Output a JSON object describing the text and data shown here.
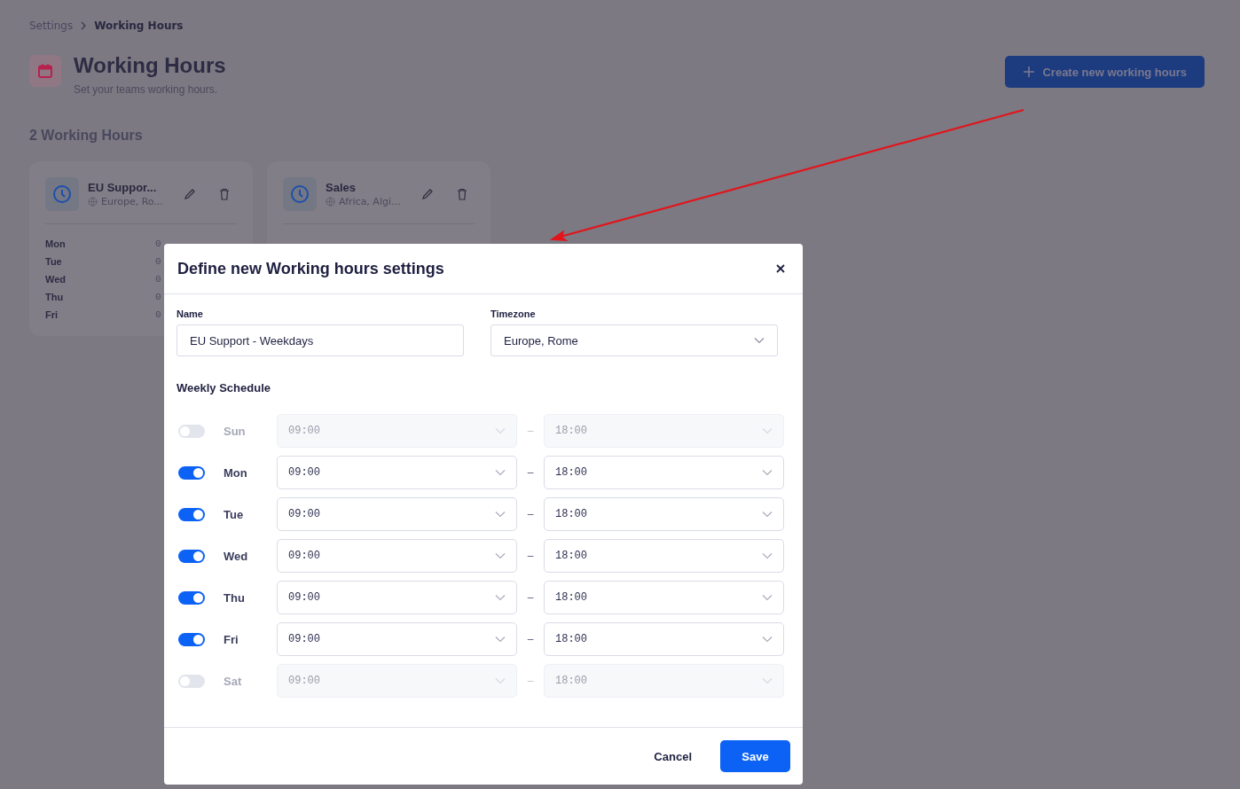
{
  "breadcrumb": [
    {
      "label": "Settings"
    },
    {
      "label": "Working Hours"
    }
  ],
  "header": {
    "title": "Working Hours",
    "subtitle": "Set your teams working hours."
  },
  "create_button": {
    "label": "Create new working hours"
  },
  "list_heading": "2 Working Hours",
  "cards": [
    {
      "name": "EU Suppor...",
      "timezone": "Europe, Ro...",
      "days": [
        {
          "day": "Mon",
          "time": "0"
        },
        {
          "day": "Tue",
          "time": "0"
        },
        {
          "day": "Wed",
          "time": "0"
        },
        {
          "day": "Thu",
          "time": "0"
        },
        {
          "day": "Fri",
          "time": "0"
        }
      ]
    },
    {
      "name": "Sales",
      "timezone": "Africa, Algi..."
    }
  ],
  "modal": {
    "title": "Define new Working hours settings",
    "name_field": {
      "label": "Name",
      "value": "EU Support - Weekdays"
    },
    "timezone_field": {
      "label": "Timezone",
      "value": "Europe, Rome"
    },
    "schedule_heading": "Weekly Schedule",
    "days": [
      {
        "day": "Sun",
        "enabled": false,
        "start": "09:00",
        "end": "18:00"
      },
      {
        "day": "Mon",
        "enabled": true,
        "start": "09:00",
        "end": "18:00"
      },
      {
        "day": "Tue",
        "enabled": true,
        "start": "09:00",
        "end": "18:00"
      },
      {
        "day": "Wed",
        "enabled": true,
        "start": "09:00",
        "end": "18:00"
      },
      {
        "day": "Thu",
        "enabled": true,
        "start": "09:00",
        "end": "18:00"
      },
      {
        "day": "Fri",
        "enabled": true,
        "start": "09:00",
        "end": "18:00"
      },
      {
        "day": "Sat",
        "enabled": false,
        "start": "09:00",
        "end": "18:00"
      }
    ],
    "separator": "–",
    "cancel_button": "Cancel",
    "save_button": "Save"
  }
}
